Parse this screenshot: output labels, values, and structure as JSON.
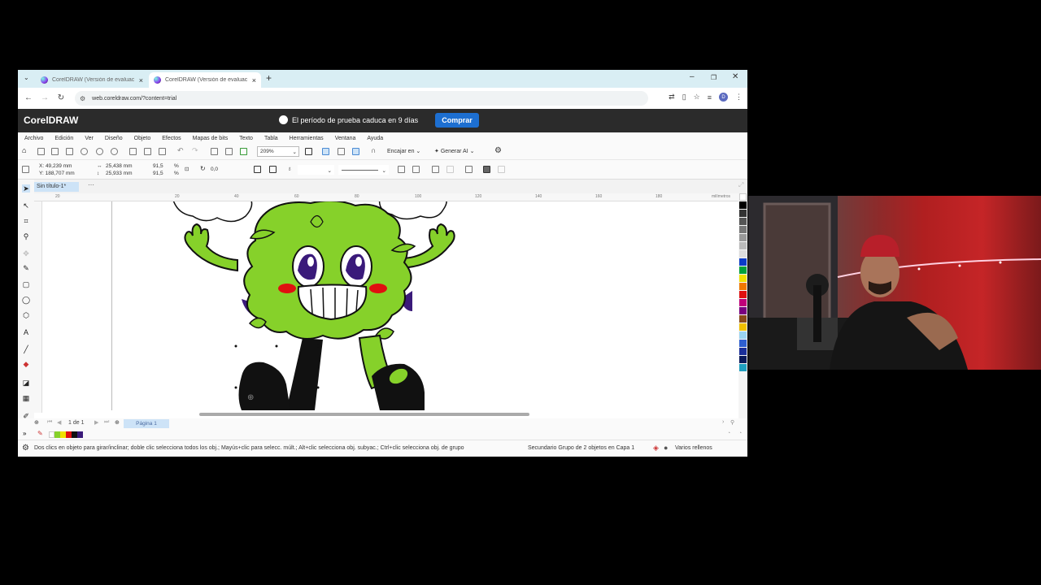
{
  "browser": {
    "tabs": [
      {
        "title": "CorelDRAW (Versión de evaluac"
      },
      {
        "title": "CorelDRAW (Versión de evaluac"
      }
    ],
    "url": "web.coreldraw.com/?content=trial",
    "profile_initial": "D"
  },
  "corel": {
    "logo": "CorelDRAW",
    "trial_message": "El período de prueba caduca en 9 días",
    "buy_label": "Comprar"
  },
  "menu": [
    "Archivo",
    "Edición",
    "Ver",
    "Diseño",
    "Objeto",
    "Efectos",
    "Mapas de bits",
    "Texto",
    "Tabla",
    "Herramientas",
    "Ventana",
    "Ayuda"
  ],
  "toolbar": {
    "zoom": "209%",
    "snap_label": "Encajar en",
    "generate_label": "Generar AI"
  },
  "propertybar": {
    "x": "X: 49,239 mm",
    "y": "Y: 188,707 mm",
    "w": "25,438 mm",
    "h": "25,933 mm",
    "sx": "91,5",
    "sy": "91,5",
    "pct1": "%",
    "pct2": "%",
    "rotation": "0,0"
  },
  "document": {
    "tab_title": "Sin título-1*"
  },
  "ruler": {
    "ticks": [
      "20",
      "20",
      "40",
      "60",
      "80",
      "100",
      "120",
      "140",
      "160",
      "180"
    ],
    "unit": "milímetros"
  },
  "pagenav": {
    "page_info": "1 de 1",
    "page_tab": "Página 1"
  },
  "status": {
    "hint": "Dos clics en objeto para girar/inclinar; doble clic selecciona todos los obj.; Mayús+clic para selecc. múlt.; Alt+clic selecciona obj. subyac.; Ctrl+clic selecciona obj. de grupo",
    "selection": "Secundario Grupo de 2 objetos en Capa 1",
    "fill": "Varios rellenos"
  },
  "colors": {
    "character_green": "#86d12a",
    "outline": "#111111",
    "eye_purple": "#3a1a7a",
    "cheek_red": "#e01010",
    "accent_blue": "#1d6fd1"
  }
}
